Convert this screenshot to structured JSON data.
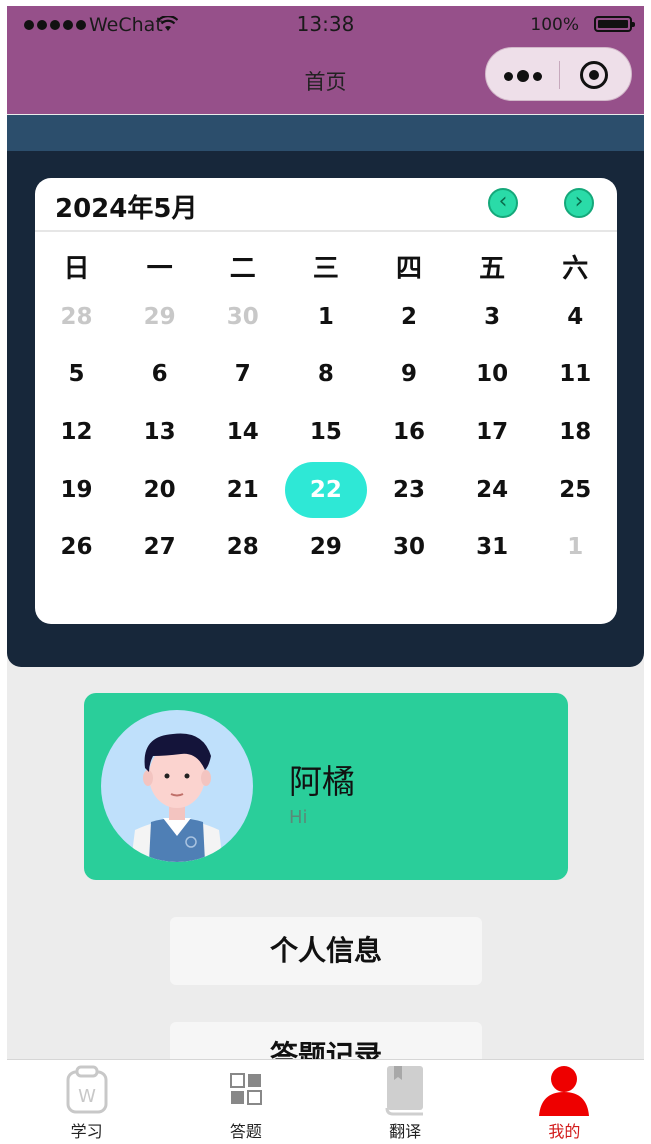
{
  "status_bar": {
    "carrier": "WeChat",
    "time": "13:38",
    "battery": "100%"
  },
  "nav": {
    "title": "首页"
  },
  "calendar": {
    "title": "2024年5月",
    "weekdays": [
      "日",
      "一",
      "二",
      "三",
      "四",
      "五",
      "六"
    ],
    "days": [
      {
        "d": "28",
        "muted": true
      },
      {
        "d": "29",
        "muted": true
      },
      {
        "d": "30",
        "muted": true
      },
      {
        "d": "1"
      },
      {
        "d": "2"
      },
      {
        "d": "3"
      },
      {
        "d": "4"
      },
      {
        "d": "5"
      },
      {
        "d": "6"
      },
      {
        "d": "7"
      },
      {
        "d": "8"
      },
      {
        "d": "9"
      },
      {
        "d": "10"
      },
      {
        "d": "11"
      },
      {
        "d": "12"
      },
      {
        "d": "13"
      },
      {
        "d": "14"
      },
      {
        "d": "15"
      },
      {
        "d": "16"
      },
      {
        "d": "17"
      },
      {
        "d": "18"
      },
      {
        "d": "19"
      },
      {
        "d": "20"
      },
      {
        "d": "21"
      },
      {
        "d": "22",
        "selected": true
      },
      {
        "d": "23"
      },
      {
        "d": "24"
      },
      {
        "d": "25"
      },
      {
        "d": "26"
      },
      {
        "d": "27"
      },
      {
        "d": "28"
      },
      {
        "d": "29"
      },
      {
        "d": "30"
      },
      {
        "d": "31"
      },
      {
        "d": "1",
        "muted": true
      }
    ],
    "accent": "#2ee8d6",
    "nav_button_color": "#2adba8"
  },
  "profile": {
    "name": "阿橘",
    "greeting": "Hi",
    "card_color": "#2ace9a"
  },
  "menu": [
    {
      "label": "个人信息"
    },
    {
      "label": "答题记录"
    }
  ],
  "tabs": [
    {
      "label": "学习",
      "icon": "study-icon"
    },
    {
      "label": "答题",
      "icon": "grid-icon"
    },
    {
      "label": "翻译",
      "icon": "book-icon"
    },
    {
      "label": "我的",
      "icon": "profile-icon",
      "active": true
    }
  ],
  "colors": {
    "header": "#96508a",
    "dark_panel": "#17273a",
    "active_tab": "#d21a1a"
  }
}
